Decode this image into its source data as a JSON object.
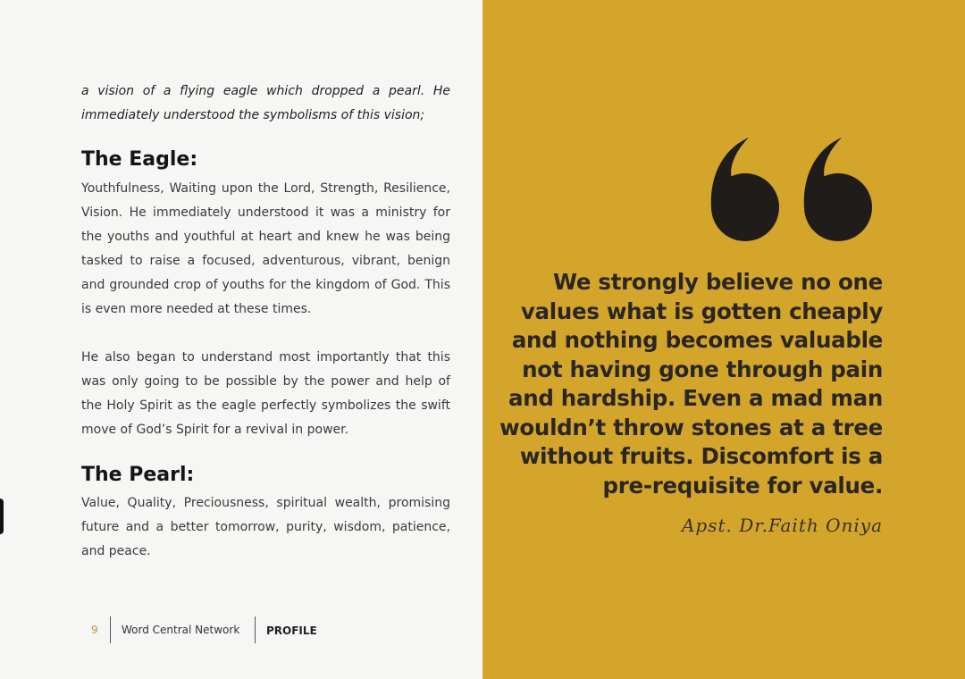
{
  "intro": {
    "line1": "a vision of a flying eagle which dropped a pearl. He",
    "line2": "immediately understood the symbolisms of this vision;"
  },
  "eagle": {
    "heading": "The Eagle:",
    "paragraph1": "Youthfulness, Waiting upon the Lord, Strength, Resilience, Vision. He immediately understood it was a ministry for the youths and youthful at heart and knew he was being tasked to raise a focused, adventurous, vibrant, benign and grounded crop of youths for the kingdom of God. This is even more needed at these times.",
    "paragraph2": "He also began to understand most importantly that this was only going to be possible by the power and help of the Holy Spirit as the eagle perfectly symbolizes the swift move of God’s Spirit for a revival in power."
  },
  "pearl": {
    "heading": "The Pearl:",
    "paragraph": "Value, Quality, Preciousness, spiritual wealth, promising future and a better tomorrow, purity, wisdom, patience, and peace."
  },
  "footer": {
    "page_number": "9",
    "organization": "Word Central Network",
    "section": "PROFILE"
  },
  "quote": {
    "text": "We strongly believe no one values what is gotten cheaply and nothing becomes valuable not having gone through pain and hardship. Even a mad man wouldn’t throw stones at a tree without fruits. Discomfort is a pre-requisite for value.",
    "author": "Apst. Dr.Faith Oniya",
    "icon": "quote-marks-icon"
  },
  "colors": {
    "accent": "#d4a52b",
    "text_dark": "#2a2624",
    "page_number": "#c49a3a"
  }
}
